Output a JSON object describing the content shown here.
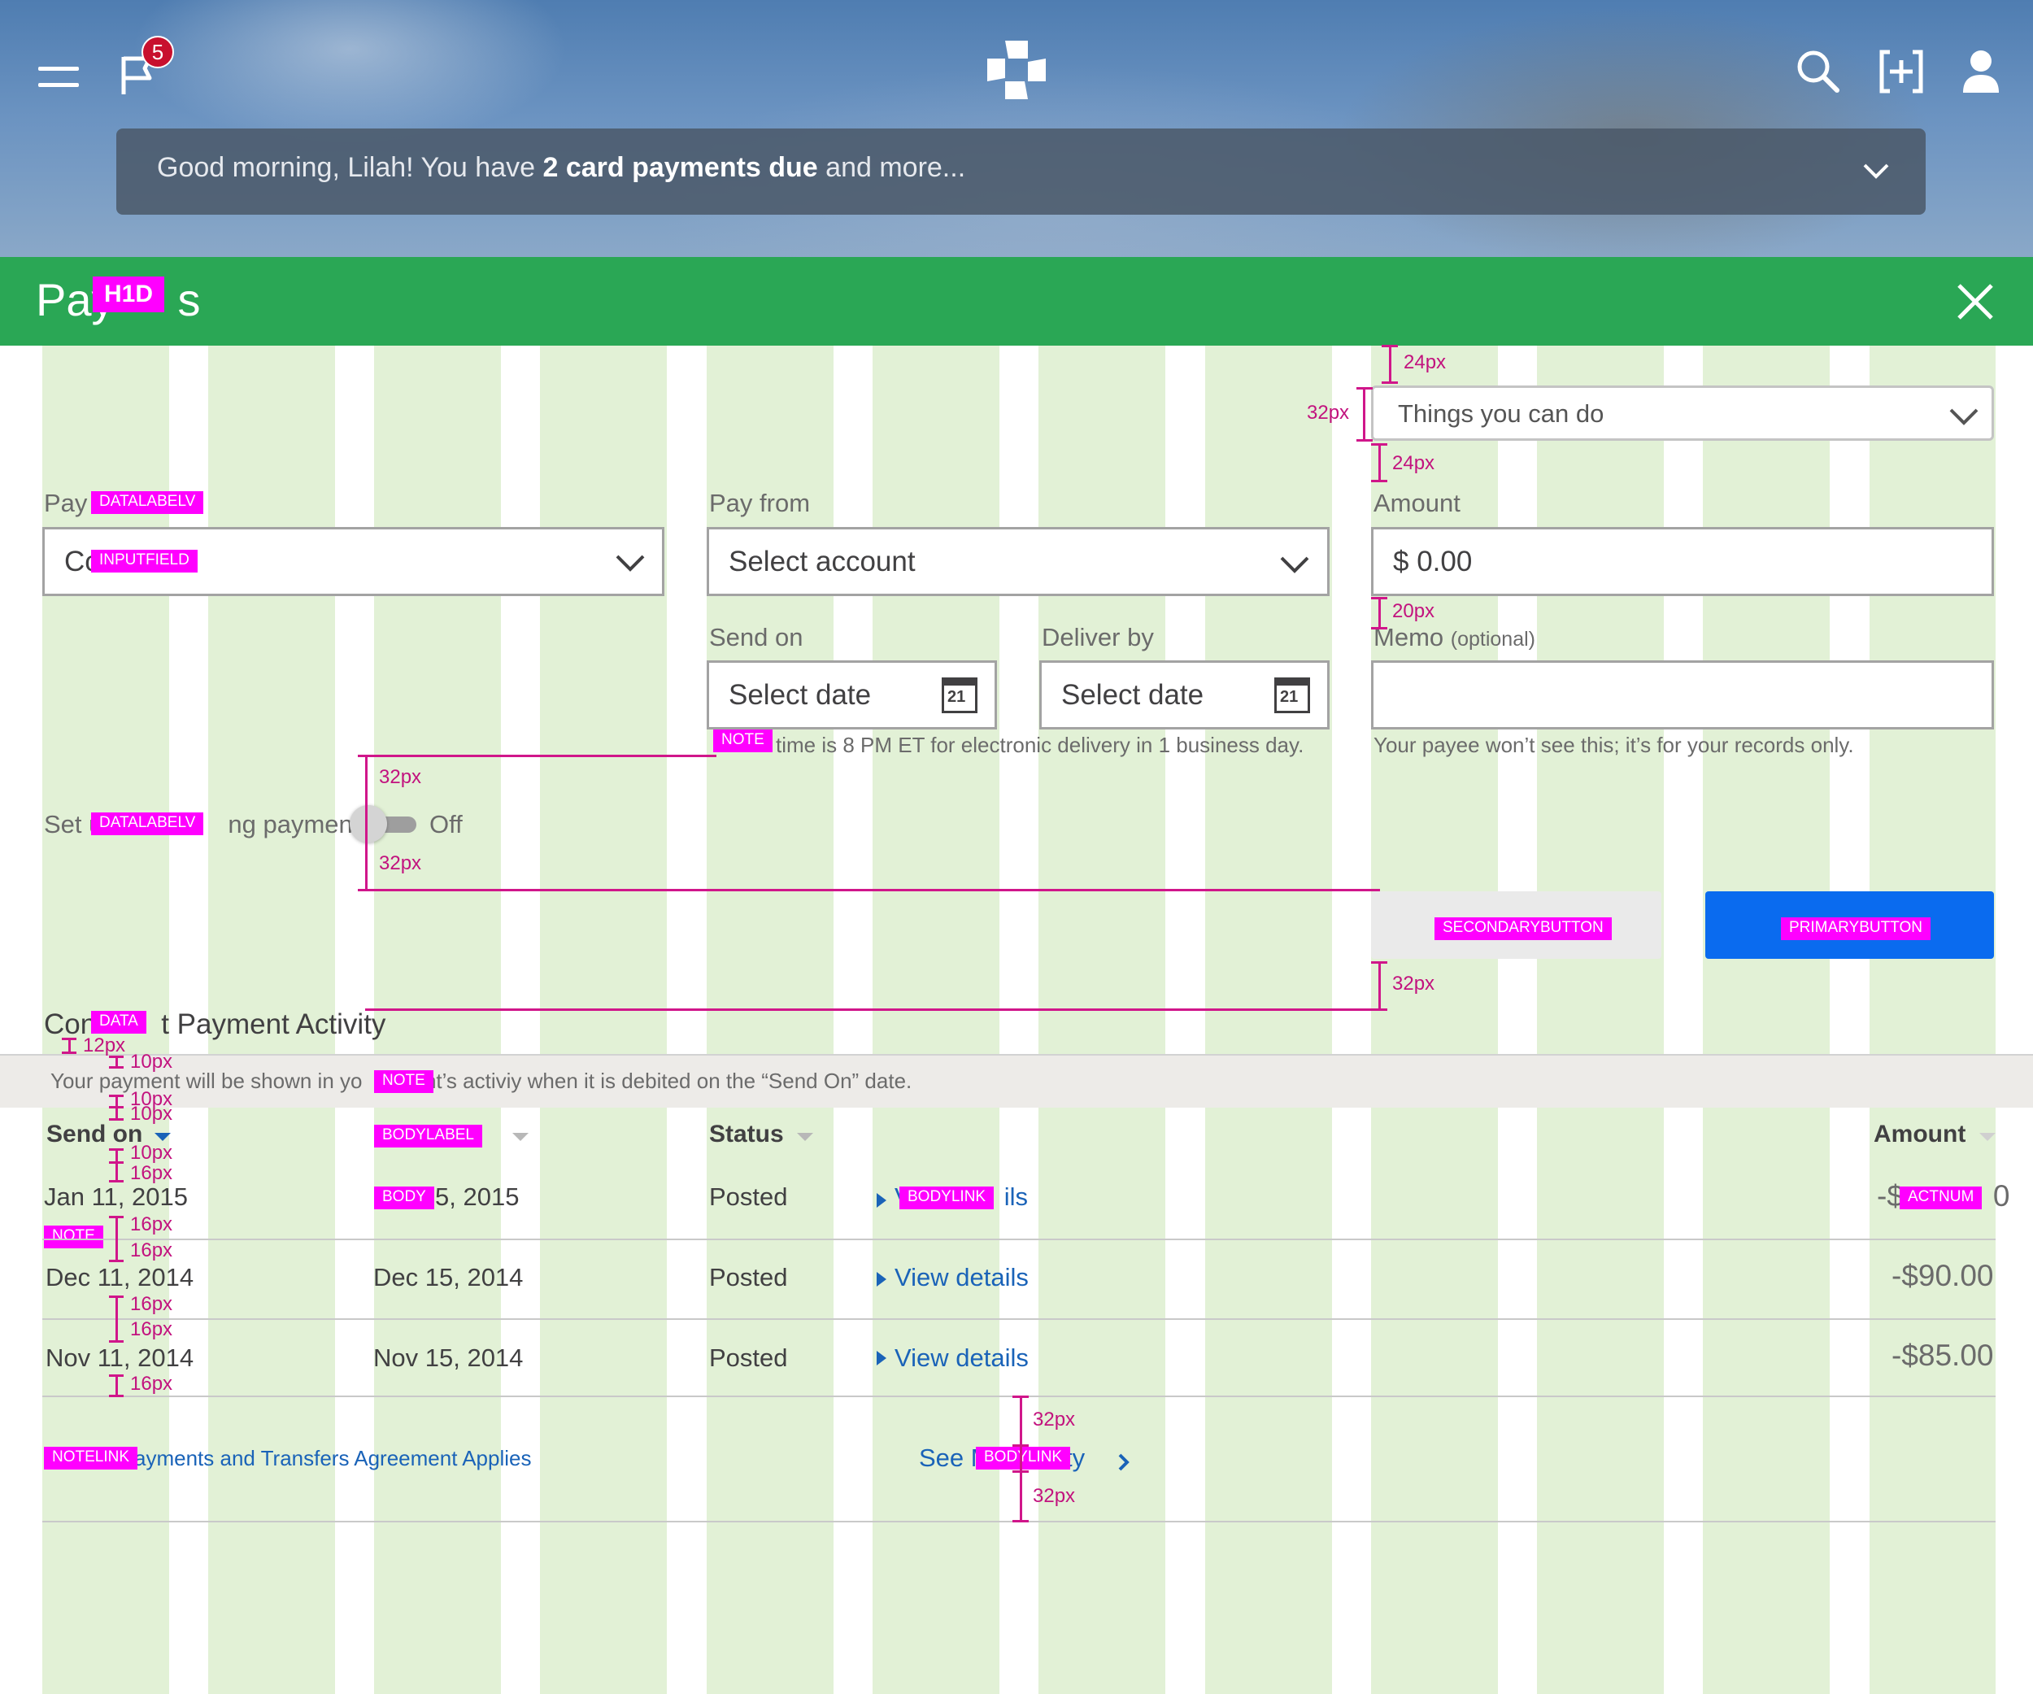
{
  "header": {
    "notification_count": "5",
    "brand_logo": "chase-octagon-logo",
    "icons": [
      "menu-icon",
      "flag-icon",
      "search-icon",
      "transfer-icon",
      "profile-icon"
    ]
  },
  "banner": {
    "greeting": "Good morning, Lilah!  You have ",
    "emphasis": "2 card payments due",
    "suffix": " and more..."
  },
  "page": {
    "title_start": "Pay",
    "title_end": "s",
    "title_tag": "H1D"
  },
  "things_dropdown": {
    "value": "Things you can do"
  },
  "form": {
    "pay_to": {
      "label_start": "Pay t",
      "label_tag": "DATALABELV",
      "value_start": "Co",
      "value_tag": "INPUTFIELD"
    },
    "pay_from": {
      "label": "Pay from",
      "value": "Select account"
    },
    "amount": {
      "label": "Amount",
      "value": "$ 0.00"
    },
    "send_on": {
      "label": "Send on",
      "value": "Select date",
      "calendar_day": "21"
    },
    "deliver_by": {
      "label": "Deliver by",
      "value": "Select date",
      "calendar_day": "21"
    },
    "memo": {
      "label": "Memo",
      "optional": "(optional)",
      "value": "",
      "help": "Your payee won’t see this; it’s for your records only."
    },
    "cutoff_note": {
      "tag": "NOTE",
      "text": "time is 8 PM ET for electronic delivery in 1 business day."
    },
    "repeat": {
      "label_start": "Set u",
      "label_tag": "DATALABELV",
      "label_end": "ng payment",
      "state": "Off"
    }
  },
  "buttons": {
    "secondary_tag": "SECONDARYBUTTON",
    "primary_tag": "PRIMARYBUTTON"
  },
  "activity": {
    "title_start": "Con",
    "title_tag": "DATA",
    "title_end": "t Payment Activity",
    "note_start": "Your payment will be shown in yo",
    "note_tag": "NOTE",
    "note_end": "unt’s activiy when it is debited on the “Send On” date.",
    "columns": {
      "send_on": "Send on",
      "deliver_tag": "BODYLABEL",
      "deliver_end": "y",
      "status": "Status",
      "amount": "Amount"
    },
    "rows": [
      {
        "send_on": "Jan 11, 2015",
        "deliver_tag": "BODY",
        "deliver_end": "5, 2015",
        "status": "Posted",
        "link_start": "V",
        "link_tag": "BODYLINK",
        "link_end": "ils",
        "amount_start": "-$",
        "amount_tag": "ACTNUM",
        "amount_end": "0"
      },
      {
        "send_on": "Dec 11, 2014",
        "deliver_by": "Dec 15, 2014",
        "status": "Posted",
        "link": "View details",
        "amount": "-$90.00"
      },
      {
        "send_on": "Nov 11, 2014",
        "deliver_by": "Nov 15, 2014",
        "status": "Posted",
        "link": "View details",
        "amount": "-$85.00"
      }
    ],
    "row_note_tag": "NOTE",
    "agreement_tag": "NOTELINK",
    "agreement_text": "ayments and Transfers Agreement Applies",
    "see_more_start": "See M",
    "see_more_tag": "BODYLINK",
    "see_more_end": "vity"
  },
  "measurements": {
    "m24a": "24px",
    "m32a": "32px",
    "m24b": "24px",
    "m20": "20px",
    "m32b": "32px",
    "m32c": "32px",
    "m32d": "32px",
    "m12": "12px",
    "m10a": "10px",
    "m10b": "10px",
    "m10c": "10px",
    "m10d": "10px",
    "m16a": "16px",
    "m16b": "16px",
    "m16c": "16px",
    "m16d": "16px",
    "m16e": "16px",
    "m16f": "16px",
    "m32e": "32px",
    "m32f": "32px"
  },
  "colors": {
    "header_green": "#2aa755",
    "grid_green": "#e2f1d6",
    "annotation_magenta": "#ff00ff",
    "primary_blue": "#0a6bef",
    "link_blue": "#1a63b8"
  }
}
